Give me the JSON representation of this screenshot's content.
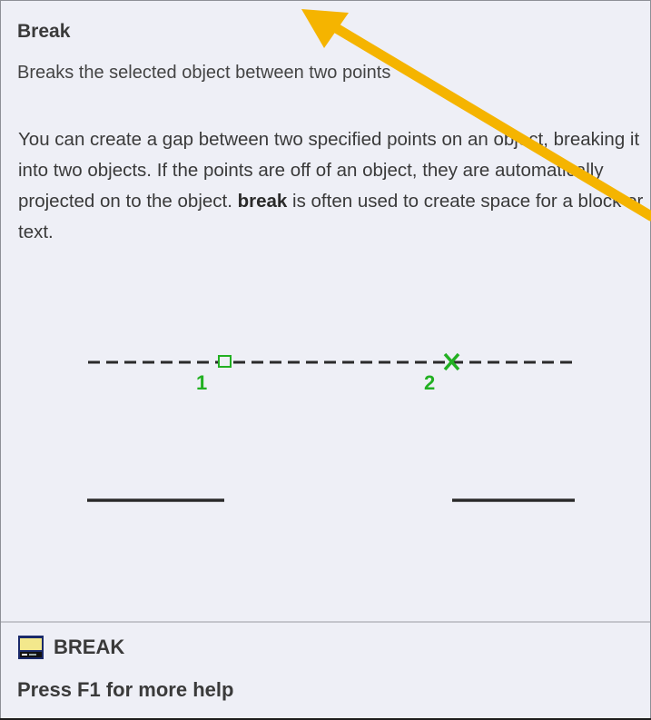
{
  "tooltip": {
    "title": "Break",
    "summary": "Breaks the selected object between two points",
    "description": {
      "part1": "You can create a gap between two specified points on an object, breaking it into two objects. If the points are off of an object, they are automatically projected on to the object. ",
      "keyword": "break",
      "part2": " is often used to create space for a block or text."
    },
    "illustration": {
      "point1_label": "1",
      "point2_label": "2",
      "accent_color": "#22b022"
    },
    "command": {
      "name": "BREAK",
      "icon": "command-window-icon"
    },
    "help_text": "Press F1 for more help"
  },
  "annotation": {
    "arrow_color": "#f5b400"
  }
}
